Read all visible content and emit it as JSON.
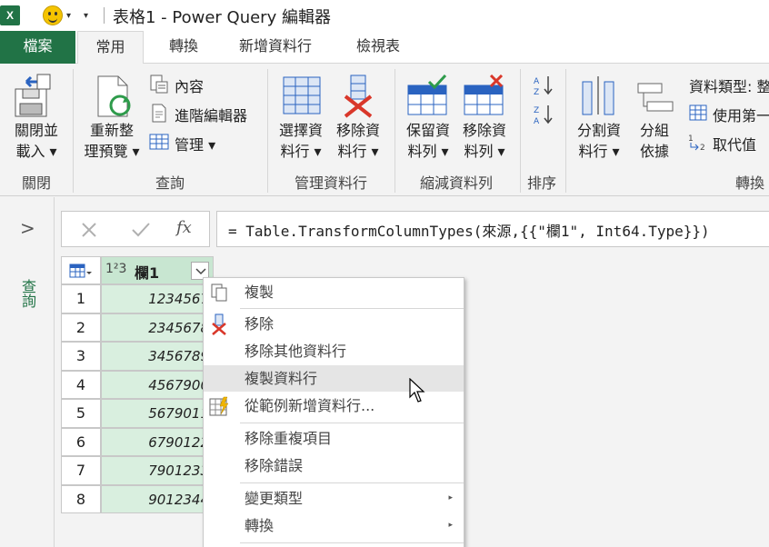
{
  "titlebar": {
    "app_icon": "X",
    "title": "表格1 - Power Query 編輯器"
  },
  "tabs": [
    {
      "label": "檔案"
    },
    {
      "label": "常用"
    },
    {
      "label": "轉換"
    },
    {
      "label": "新增資料行"
    },
    {
      "label": "檢視表"
    }
  ],
  "ribbon": {
    "close": {
      "btn_line1": "關閉並",
      "btn_line2": "載入 ▾",
      "group": "關閉"
    },
    "query": {
      "refresh_line1": "重新整",
      "refresh_line2": "理預覽 ▾",
      "properties": "內容",
      "advanced_editor": "進階編輯器",
      "manage": "管理 ▾",
      "group": "查詢"
    },
    "manage_cols": {
      "choose_line1": "選擇資",
      "choose_line2": "料行 ▾",
      "remove_line1": "移除資",
      "remove_line2": "料行 ▾",
      "group": "管理資料行"
    },
    "reduce_rows": {
      "keep_line1": "保留資",
      "keep_line2": "料列 ▾",
      "remove_line1": "移除資",
      "remove_line2": "料列 ▾",
      "group": "縮減資料列"
    },
    "sort": {
      "group": "排序"
    },
    "transform": {
      "split_line1": "分割資",
      "split_line2": "料行 ▾",
      "group_line1": "分組",
      "group_line2": "依據",
      "data_type": "資料類型: 整",
      "use_first_row": "使用第一",
      "replace_values": "取代值",
      "group": "轉換"
    }
  },
  "formula_bar": {
    "formula": "= Table.TransformColumnTypes(來源,{{\"欄1\", Int64.Type}})",
    "fx": "fx"
  },
  "queries_pane": {
    "label": "查詢"
  },
  "grid": {
    "type_icon": "1²3",
    "column_header": "欄1",
    "rows": [
      {
        "n": "1",
        "v": "1234567"
      },
      {
        "n": "2",
        "v": "2345678"
      },
      {
        "n": "3",
        "v": "3456789"
      },
      {
        "n": "4",
        "v": "4567900"
      },
      {
        "n": "5",
        "v": "5679011"
      },
      {
        "n": "6",
        "v": "6790122"
      },
      {
        "n": "7",
        "v": "7901233"
      },
      {
        "n": "8",
        "v": "9012344"
      }
    ]
  },
  "context_menu": {
    "copy": "複製",
    "remove": "移除",
    "remove_other": "移除其他資料行",
    "duplicate": "複製資料行",
    "from_examples": "從範例新增資料行...",
    "remove_duplicates": "移除重複項目",
    "remove_errors": "移除錯誤",
    "change_type": "變更類型",
    "transform": "轉換"
  },
  "colors": {
    "accent": "#217346",
    "column_fill": "#d9efdf",
    "header_fill": "#c8e6d1"
  }
}
